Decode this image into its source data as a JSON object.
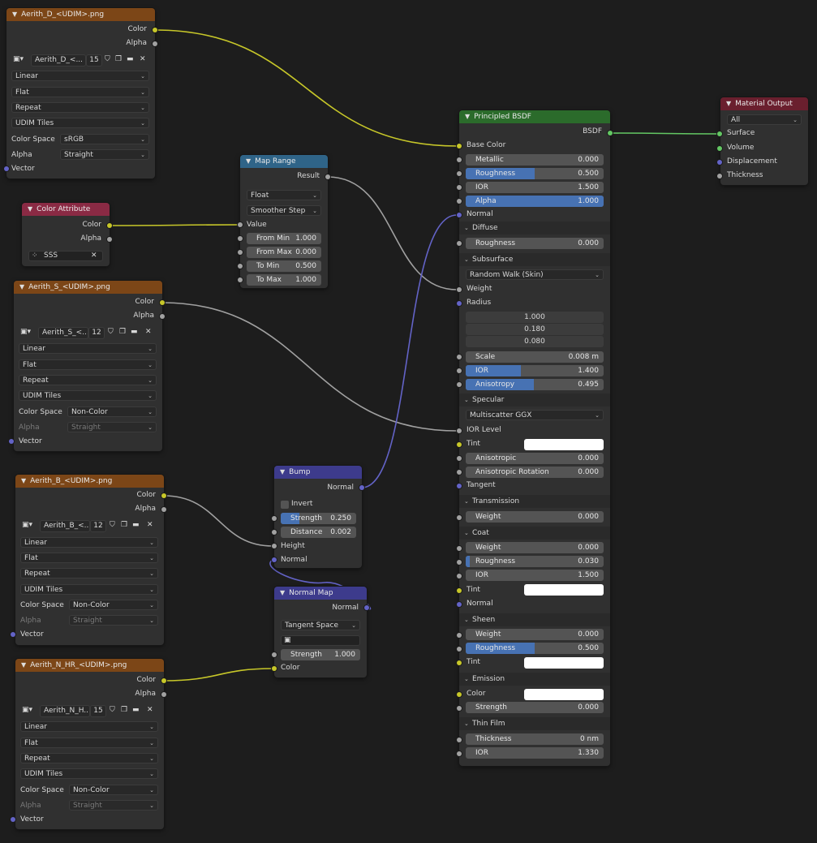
{
  "colors": {
    "image_header": "#7c4617",
    "attribute_header": "#8a2a44",
    "converter_header": "#2f6488",
    "vector_header": "#3d3b8c",
    "shader_header": "#2b6b2b",
    "output_header": "#6a1f2e",
    "color_socket": "#c7c729",
    "float_socket": "#a1a1a1",
    "vector_socket": "#6363c7",
    "shader_socket": "#63c763",
    "slider_fill": "#4772b3"
  },
  "image_d": {
    "title": "Aerith_D_<UDIM>.png",
    "out_color": "Color",
    "out_alpha": "Alpha",
    "img_name": "Aerith_D_<...",
    "users": "15",
    "interpolation": "Linear",
    "projection": "Flat",
    "extension": "Repeat",
    "source": "UDIM Tiles",
    "cs_label": "Color Space",
    "cs_value": "sRGB",
    "alpha_label": "Alpha",
    "alpha_value": "Straight",
    "in_vector": "Vector"
  },
  "image_s": {
    "title": "Aerith_S_<UDIM>.png",
    "out_color": "Color",
    "out_alpha": "Alpha",
    "img_name": "Aerith_S_<...",
    "users": "12",
    "interpolation": "Linear",
    "projection": "Flat",
    "extension": "Repeat",
    "source": "UDIM Tiles",
    "cs_label": "Color Space",
    "cs_value": "Non-Color",
    "alpha_label": "Alpha",
    "alpha_value": "Straight",
    "in_vector": "Vector"
  },
  "image_b": {
    "title": "Aerith_B_<UDIM>.png",
    "out_color": "Color",
    "out_alpha": "Alpha",
    "img_name": "Aerith_B_<...",
    "users": "12",
    "interpolation": "Linear",
    "projection": "Flat",
    "extension": "Repeat",
    "source": "UDIM Tiles",
    "cs_label": "Color Space",
    "cs_value": "Non-Color",
    "alpha_label": "Alpha",
    "alpha_value": "Straight",
    "in_vector": "Vector"
  },
  "image_n": {
    "title": "Aerith_N_HR_<UDIM>.png",
    "out_color": "Color",
    "out_alpha": "Alpha",
    "img_name": "Aerith_N_H...",
    "users": "15",
    "interpolation": "Linear",
    "projection": "Flat",
    "extension": "Repeat",
    "source": "UDIM Tiles",
    "cs_label": "Color Space",
    "cs_value": "Non-Color",
    "alpha_label": "Alpha",
    "alpha_value": "Straight",
    "in_vector": "Vector"
  },
  "color_attribute": {
    "title": "Color Attribute",
    "out_color": "Color",
    "out_alpha": "Alpha",
    "name": "SSS"
  },
  "map_range": {
    "title": "Map Range",
    "out_result": "Result",
    "data_type": "Float",
    "interpolation": "Smoother Step",
    "in_value": "Value",
    "from_min_label": "From Min",
    "from_min": "1.000",
    "from_max_label": "From Max",
    "from_max": "0.000",
    "to_min_label": "To Min",
    "to_min": "0.500",
    "to_max_label": "To Max",
    "to_max": "1.000"
  },
  "bump": {
    "title": "Bump",
    "out_normal": "Normal",
    "invert": "Invert",
    "strength_label": "Strength",
    "strength": "0.250",
    "distance_label": "Distance",
    "distance": "0.002",
    "in_height": "Height",
    "in_normal": "Normal"
  },
  "normal_map": {
    "title": "Normal Map",
    "out_normal": "Normal",
    "space": "Tangent Space",
    "strength_label": "Strength",
    "strength": "1.000",
    "in_color": "Color"
  },
  "bsdf": {
    "title": "Principled BSDF",
    "out_bsdf": "BSDF",
    "base_color": "Base Color",
    "metallic_label": "Metallic",
    "metallic": "0.000",
    "roughness_label": "Roughness",
    "roughness": "0.500",
    "roughness_level": 0.5,
    "ior_label": "IOR",
    "ior": "1.500",
    "alpha_label": "Alpha",
    "alpha": "1.000",
    "alpha_level": 1.0,
    "normal": "Normal",
    "diffuse": {
      "title": "Diffuse",
      "roughness_label": "Roughness",
      "roughness": "0.000"
    },
    "subsurface": {
      "title": "Subsurface",
      "method": "Random Walk (Skin)",
      "weight": "Weight",
      "radius": "Radius",
      "radius_values": [
        "1.000",
        "0.180",
        "0.080"
      ],
      "scale_label": "Scale",
      "scale": "0.008 m",
      "ior_label": "IOR",
      "ior": "1.400",
      "ior_level": 0.4,
      "aniso_label": "Anisotropy",
      "aniso": "0.495",
      "aniso_level": 0.495
    },
    "specular": {
      "title": "Specular",
      "distribution": "Multiscatter GGX",
      "ior_level": "IOR Level",
      "tint": "Tint",
      "anisotropic_label": "Anisotropic",
      "anisotropic": "0.000",
      "aniso_rot_label": "Anisotropic Rotation",
      "aniso_rot": "0.000",
      "tangent": "Tangent"
    },
    "transmission": {
      "title": "Transmission",
      "weight_label": "Weight",
      "weight": "0.000"
    },
    "coat": {
      "title": "Coat",
      "weight_label": "Weight",
      "weight": "0.000",
      "roughness_label": "Roughness",
      "roughness": "0.030",
      "roughness_level": 0.03,
      "ior_label": "IOR",
      "ior": "1.500",
      "tint": "Tint",
      "normal": "Normal"
    },
    "sheen": {
      "title": "Sheen",
      "weight_label": "Weight",
      "weight": "0.000",
      "roughness_label": "Roughness",
      "roughness": "0.500",
      "roughness_level": 0.5,
      "tint": "Tint"
    },
    "emission": {
      "title": "Emission",
      "color": "Color",
      "strength_label": "Strength",
      "strength": "0.000"
    },
    "thin_film": {
      "title": "Thin Film",
      "thickness_label": "Thickness",
      "thickness": "0 nm",
      "ior_label": "IOR",
      "ior": "1.330"
    }
  },
  "material_output": {
    "title": "Material Output",
    "target": "All",
    "surface": "Surface",
    "volume": "Volume",
    "displacement": "Displacement",
    "thickness": "Thickness"
  }
}
